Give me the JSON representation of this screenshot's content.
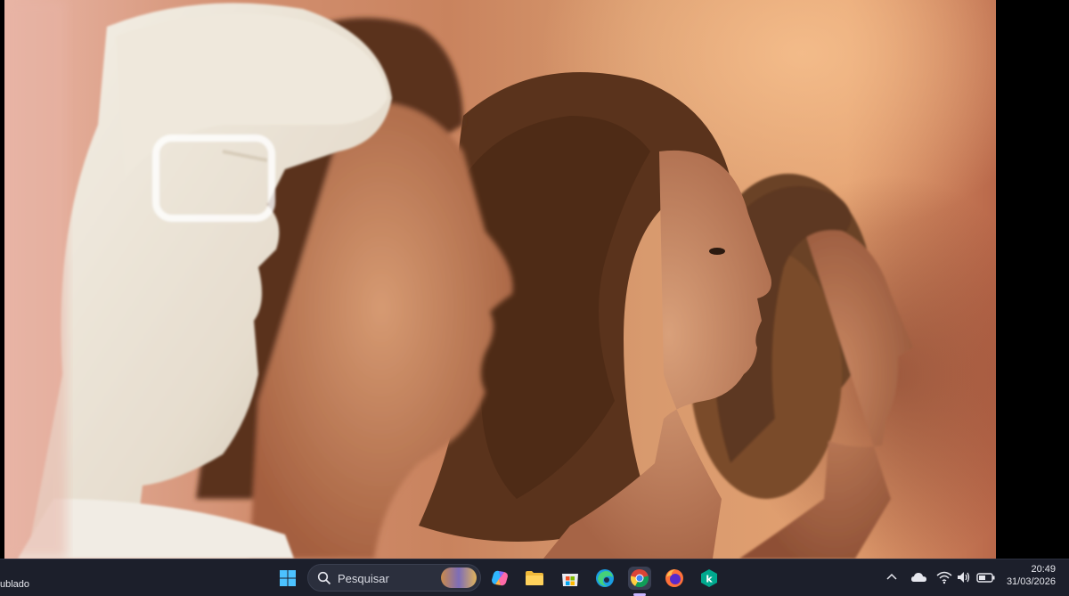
{
  "taskbar": {
    "left_text": "ublado",
    "search": {
      "label": "Pesquisar"
    },
    "apps": [
      {
        "name": "start",
        "icon": "windows-logo-icon"
      },
      {
        "name": "copilot",
        "icon": "copilot-icon"
      },
      {
        "name": "file-explorer",
        "icon": "folder-icon"
      },
      {
        "name": "microsoft-store",
        "icon": "store-icon"
      },
      {
        "name": "edge",
        "icon": "edge-icon"
      },
      {
        "name": "chrome",
        "icon": "chrome-icon",
        "active": true
      },
      {
        "name": "firefox",
        "icon": "firefox-icon"
      },
      {
        "name": "kaspersky",
        "icon": "kaspersky-icon"
      }
    ],
    "tray": {
      "time": "20:49",
      "date": "31/03/2026"
    }
  }
}
